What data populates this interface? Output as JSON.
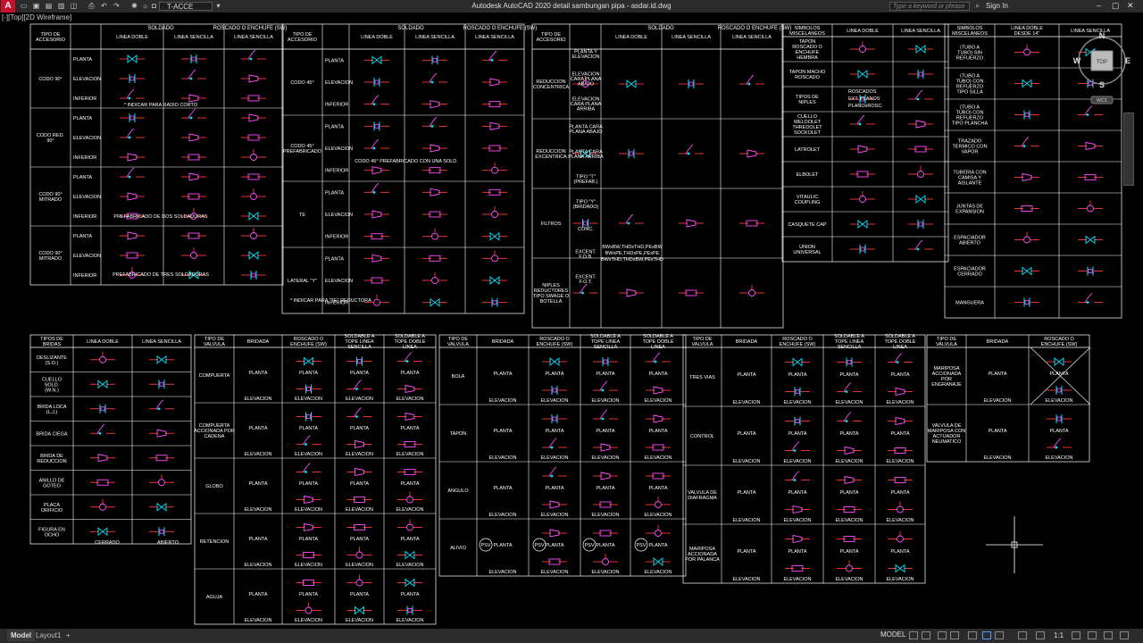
{
  "window": {
    "title": "Autodesk AutoCAD 2020   detail sambungan pipa - asdar.id.dwg",
    "app_icon_label": "A",
    "layer_name": "T-ACCE",
    "search_placeholder": "Type a keyword or phrase",
    "sign_in": "Sign In",
    "viewport_label": "[-][Top][2D Wireframe]"
  },
  "viewcube": {
    "north": "N",
    "south": "S",
    "east": "E",
    "west": "W",
    "face": "TOP",
    "wcs": "WCS"
  },
  "status": {
    "model_tab": "Model",
    "layout_tab": "Layout1",
    "add_tab": "+",
    "model_indicator": "MODEL",
    "scale": "1:1"
  },
  "colors": {
    "background": "#000000",
    "lines": "#ffffff",
    "pipe": "#ff3b3b",
    "fitting": "#ff4dff",
    "symbol": "#00e5ff",
    "accent": "#c8102e"
  },
  "table1": {
    "headers": [
      "TIPO DE ACCESORIO",
      "SOLDADO",
      "ROSCADO O ENCHUFE (SW)",
      "LINEA DOBLE",
      "LINEA SENCILLA",
      "LINEA SENCILLA"
    ],
    "views": [
      "PLANTA",
      "ELEVACION",
      "INFERIOR"
    ],
    "rows": [
      "CODO 90°",
      "CODO RED. 90°",
      "CODO 90° MITRADO",
      "CODO 90° MITRADO"
    ],
    "notes": [
      "* INDICAR PARA RADIO CORTO",
      "PREFABRICADO DE DOS SOLDADURAS",
      "PREFABRICADO DE TRES SOLDADURAS"
    ],
    "dims": [
      "R.C.*",
      "R.C.*",
      "6\"x4\"",
      "6\"x4\""
    ]
  },
  "table2": {
    "headers": [
      "TIPO DE ACCESORIO",
      "SOLDADO",
      "ROSCADO O ENCHUFE (SW)",
      "LINEA DOBLE",
      "LINEA SENCILLA",
      "LINEA SENCILLA"
    ],
    "rows": [
      "CODO 45°",
      "CODO 45° PREFABRICADO",
      "TE",
      "LATERAL \"Y\""
    ],
    "notes": [
      "CODO 45° PREFABRICADO CON UNA SOLD.",
      "* INDICAR PARA \"TE\" REDUCTORA"
    ],
    "dims": [
      "45°",
      "45°",
      "45°",
      "45°",
      "45°",
      "6\"x4\"*",
      "6\"x4\"*",
      "2\"x1\"*"
    ]
  },
  "table3": {
    "headers": [
      "TIPO DE ACCESORIO",
      "SOLDADO",
      "ROSCADO O ENCHUFE (SW)",
      "LINEA DOBLE",
      "LINEA SENCILLA",
      "LINEA SENCILLA"
    ],
    "rows": [
      "REDUCCION CONCENTRICA",
      "REDUCCION EXCENTRICA",
      "FILTROS",
      "NIPLES REDUCTORES TIPO SWAGE O BOTELLA"
    ],
    "views": [
      "PLANTA Y ELEVACION",
      "ELEVACION CARA PLANA ABAJO",
      "ELEVACION CARA PLANA ARRIBA",
      "PLANTA CARA PLANA ABAJO",
      "PLANTA CARA PLANA ARRIBA",
      "TIPO \"T\" (PREFAB.)",
      "TIPO \"Y\" (BRIDADO)",
      "CONC.",
      "EXCENT. F.O.B.",
      "EXCENT. F.O.T."
    ],
    "tags": [
      "F.O.B.",
      "F.O.B.",
      "F.O.T.",
      "F.O.T.",
      "F.O.B.",
      "F.O.B.",
      "F.O.T.",
      "F.O.T."
    ],
    "note_lines": [
      "BWxBW,THDxTHD,PExBW",
      "BWxPE,THDxPE,PExPE",
      "BWxTHD,THDxBW,PExTHD"
    ],
    "nipple_labels": [
      "BWxNPTM",
      "PExNPTM PLANTA",
      "PExNPTM PLANTA"
    ]
  },
  "table4": {
    "headers": [
      "SIMBOLOS MISCELANEOS",
      "LINEA DOBLE",
      "LINEA SENCILLA"
    ],
    "rows": [
      "TAPON ROSCADO O ENCHUFE HEMBRA",
      "TAPON MACHO ROSCADO",
      "TIPOS DE NIPLES",
      "CUELLO WELDOLET THREDOLET SOCKOLET",
      "LATROLET",
      "ELBOLET",
      "VITAULIC COUPLING",
      "CASQUETE CAP",
      "UNION UNIVERSAL"
    ],
    "nipple_types": [
      "ROSCADOS",
      "EXT. PLANOS",
      "PLANOxROSC."
    ],
    "tags": [
      "SOLDADO",
      "SOLDADO",
      "SW"
    ]
  },
  "table5": {
    "headers": [
      "SIMBOLOS MISCELANEOS",
      "LINEA DOBLE DESDE 14\"",
      "LINEA SENCILLA"
    ],
    "rows": [
      "(TUBO A TUBO) SIN REFUERZO",
      "(TUBO A TUBO) CON REFUERZO TIPO SILLA",
      "(TUBO A TUBO) CON REFUERZO TIPO PLANCHA",
      "TRAZADO TERMICO CON VAPOR",
      "TUBERIA CON CAMISA Y AISLANTE",
      "JUNTAS DE EXPANSION",
      "ESPACIADOR ABIERTO",
      "ESPACIADOR CERRADO",
      "MANGUERA"
    ],
    "tags": [
      "BRIDADA",
      "BRIDADA",
      "SOLDADA",
      "SOLDADA",
      "BRIDADA",
      "BRIDADA",
      "ROSCADA"
    ]
  },
  "table6": {
    "headers": [
      "TIPOS DE BRIDAS",
      "LINEA DOBLE",
      "LINEA SENCILLA"
    ],
    "rows": [
      "DESLIZANTE (S.O.)",
      "CUELLO SOLD. (W.N.)",
      "BRIDA LOCA (L.J.)",
      "BRIDA CIEGA",
      "BRIDA DE REDUCCION",
      "ANILLO DE GOTEO",
      "PLACA ORIFICIO",
      "FIGURA EN OCHO"
    ],
    "tags": [
      "L.J.",
      "L.J.",
      "6\"",
      "2\"",
      "6\"",
      "2\"",
      "FE",
      "FE",
      "CERRADO",
      "ABIERTO"
    ]
  },
  "table7": {
    "headers": [
      "TIPO DE VALVULA",
      "BRIDADA",
      "ROSCADO O ENCHUFE (SW)",
      "SOLDABLE A TOPE LINEA SENCILLA",
      "SOLDABLE A TOPE DOBLE LINEA"
    ],
    "rows": [
      "COMPUERTA",
      "COMPUERTA ACCIONADA POR CADENA",
      "GLOBO",
      "RETENCION",
      "AGUJA"
    ],
    "view_labels": [
      "PLANTA",
      "ELEVACION"
    ]
  },
  "table8": {
    "headers": [
      "TIPO DE VALVULA",
      "BRIDADA",
      "ROSCADO O ENCHUFE (SW)",
      "SOLDABLE A TOPE LINEA SENCILLA",
      "SOLDABLE A TOPE DOBLE LINEA"
    ],
    "rows": [
      "BOLA",
      "TAPON",
      "ANGULO",
      "ALIVIO"
    ],
    "view_labels": [
      "PLANTA",
      "ELEVACION"
    ],
    "psv": "PSV"
  },
  "table9": {
    "headers": [
      "TIPO DE VALVULA",
      "BRIDADA",
      "ROSCADO O ENCHUFE (SW)",
      "SOLDABLE A TOPE LINEA SENCILLA",
      "SOLDABLE A TOPE DOBLE LINEA"
    ],
    "rows": [
      "TRES VIAS",
      "CONTROL",
      "VALVULA DE DIAFRAGMA",
      "MARIPOSA ACCIONADA POR PALANCA"
    ],
    "view_labels": [
      "PLANTA",
      "ELEVACION"
    ]
  },
  "table10": {
    "headers": [
      "TIPO DE VALVULA",
      "BRIDADA",
      "ROSCADO O ENCHUFE (SW)"
    ],
    "rows": [
      "MARIPOSA ACCIONADA POR ENGRANAJE",
      "VALVULA DE MARIPOSA CON ACTUADOR NEUMATICO"
    ],
    "view_labels": [
      "PLANTA",
      "ELEVACION"
    ]
  }
}
